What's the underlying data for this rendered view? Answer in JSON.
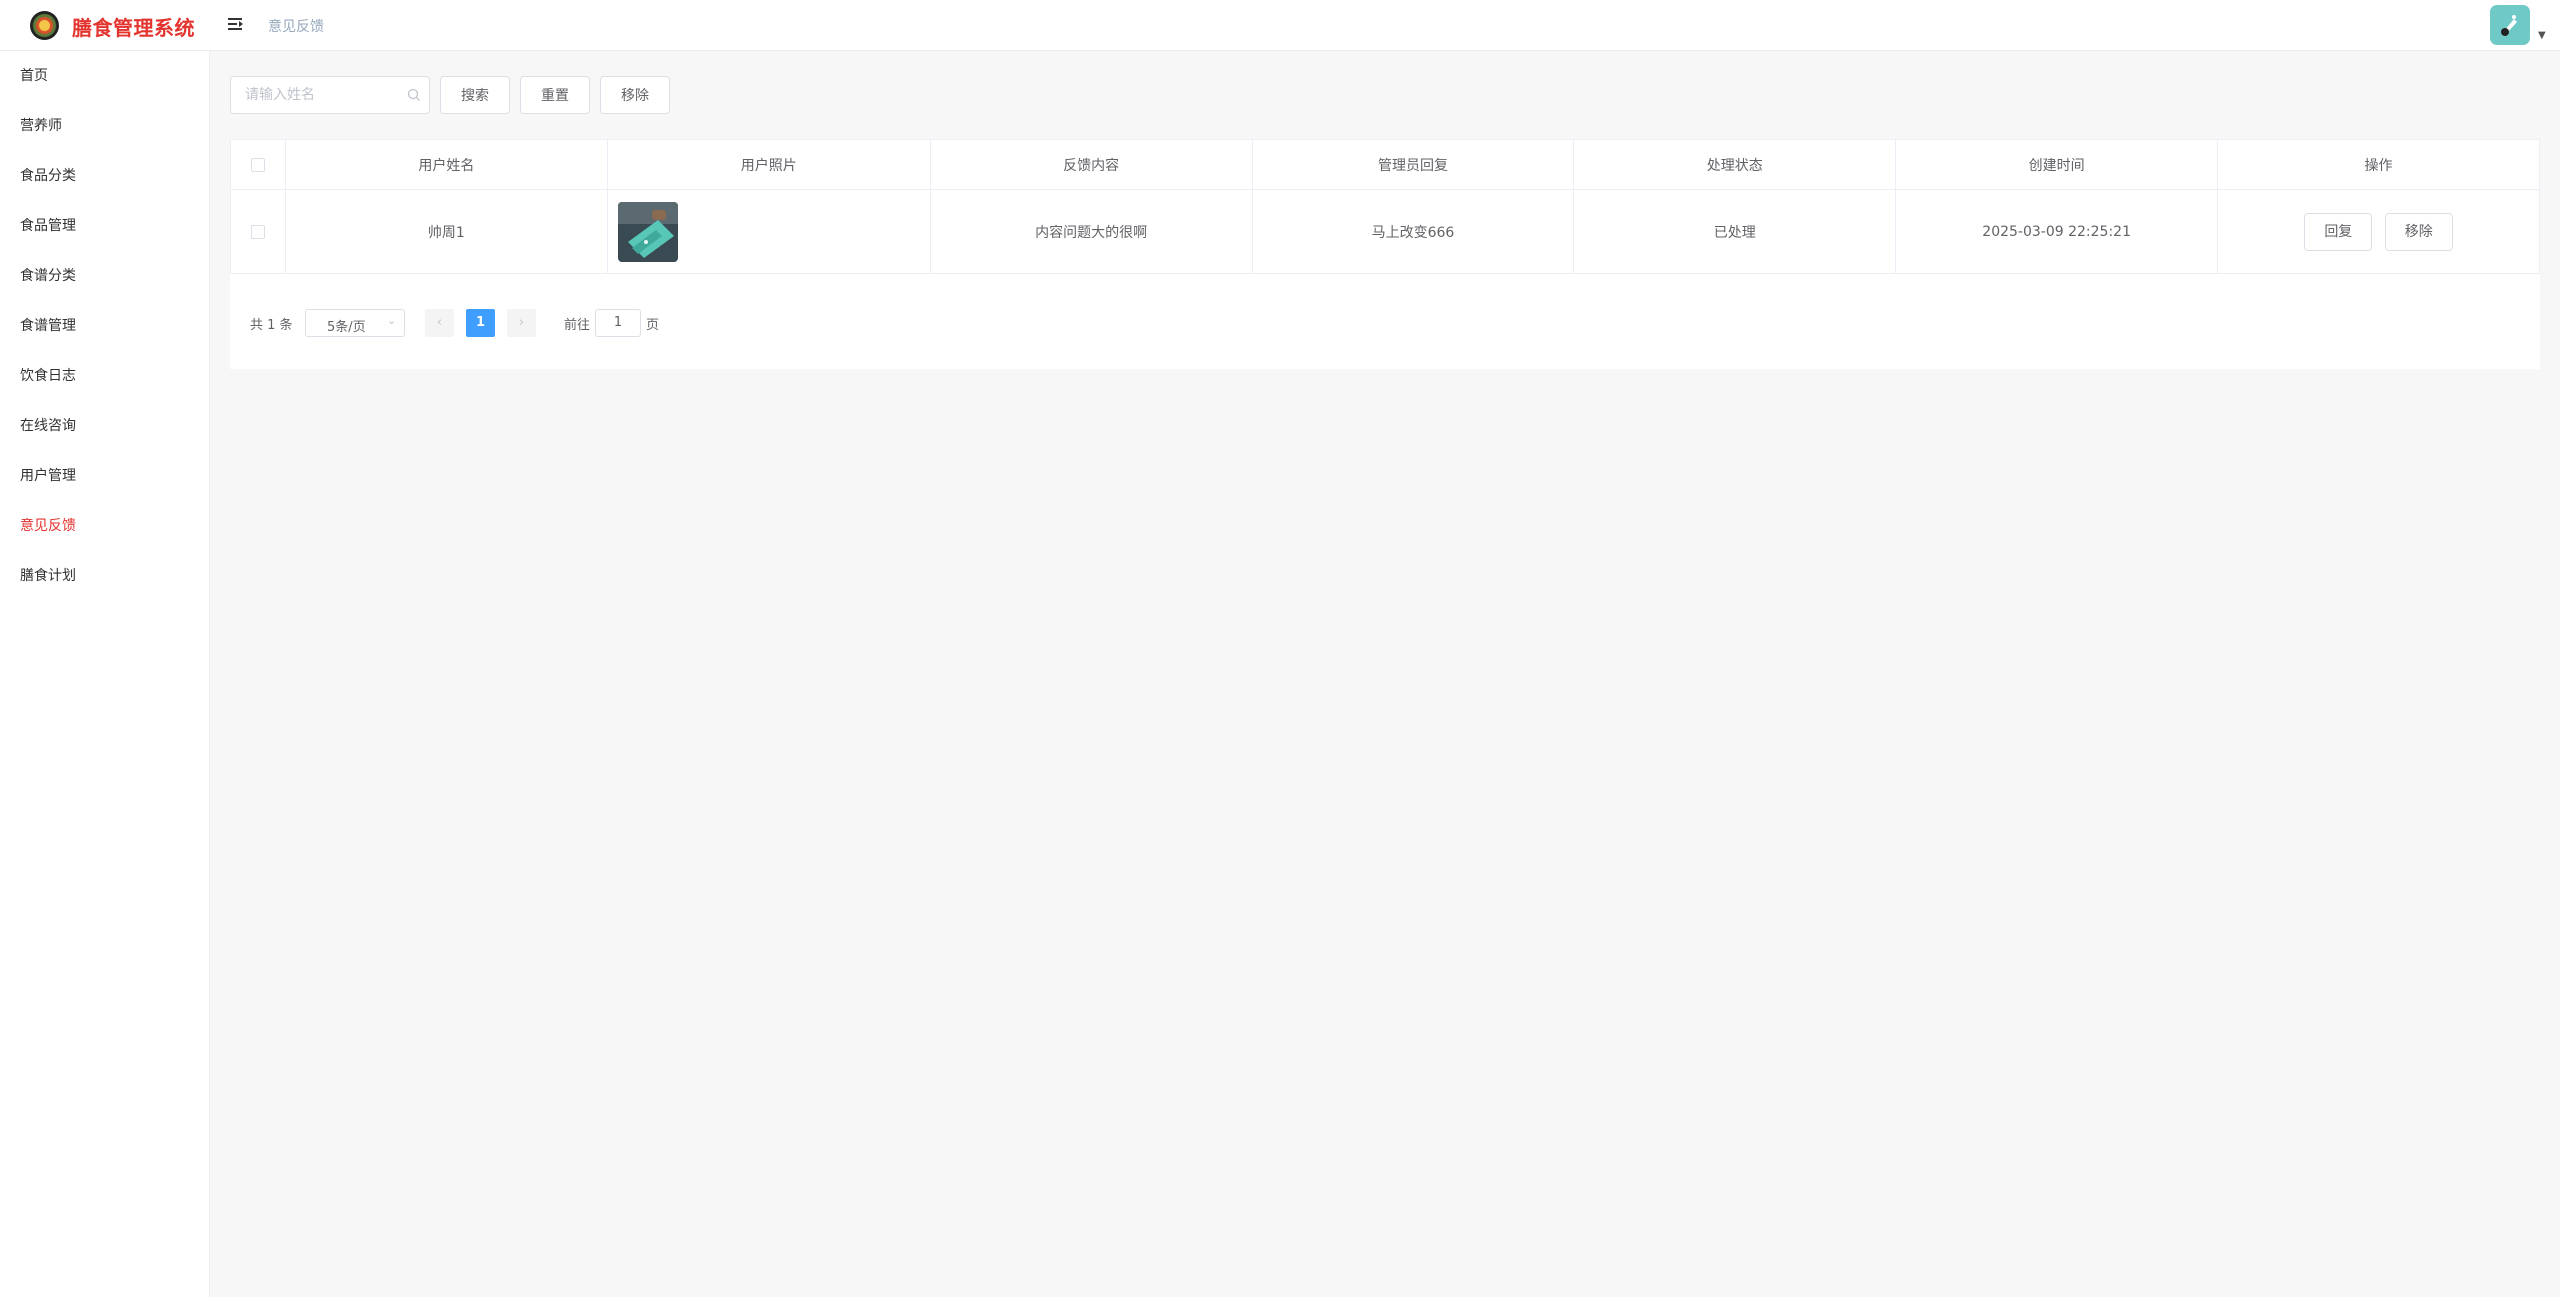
{
  "app": {
    "title": "膳食管理系统"
  },
  "header": {
    "breadcrumb": "意见反馈"
  },
  "sidebar": {
    "items": [
      {
        "label": "首页"
      },
      {
        "label": "营养师"
      },
      {
        "label": "食品分类"
      },
      {
        "label": "食品管理"
      },
      {
        "label": "食谱分类"
      },
      {
        "label": "食谱管理"
      },
      {
        "label": "饮食日志"
      },
      {
        "label": "在线咨询"
      },
      {
        "label": "用户管理"
      },
      {
        "label": "意见反馈",
        "active": true
      },
      {
        "label": "膳食计划"
      }
    ]
  },
  "toolbar": {
    "search_placeholder": "请输入姓名",
    "search_label": "搜索",
    "reset_label": "重置",
    "remove_label": "移除"
  },
  "table": {
    "columns": [
      "用户姓名",
      "用户照片",
      "反馈内容",
      "管理员回复",
      "处理状态",
      "创建时间",
      "操作"
    ],
    "rows": [
      {
        "name": "帅周1",
        "content": "内容问题大的很啊",
        "reply": "马上改变666",
        "status": "已处理",
        "created": "2025-03-09 22:25:21",
        "reply_btn": "回复",
        "remove_btn": "移除"
      }
    ]
  },
  "pagination": {
    "total": "共 1 条",
    "page_size": "5条/页",
    "current": "1",
    "goto_prefix": "前往",
    "goto_value": "1",
    "goto_suffix": "页"
  },
  "colors": {
    "accent": "#e3342f",
    "primary": "#409eff"
  }
}
